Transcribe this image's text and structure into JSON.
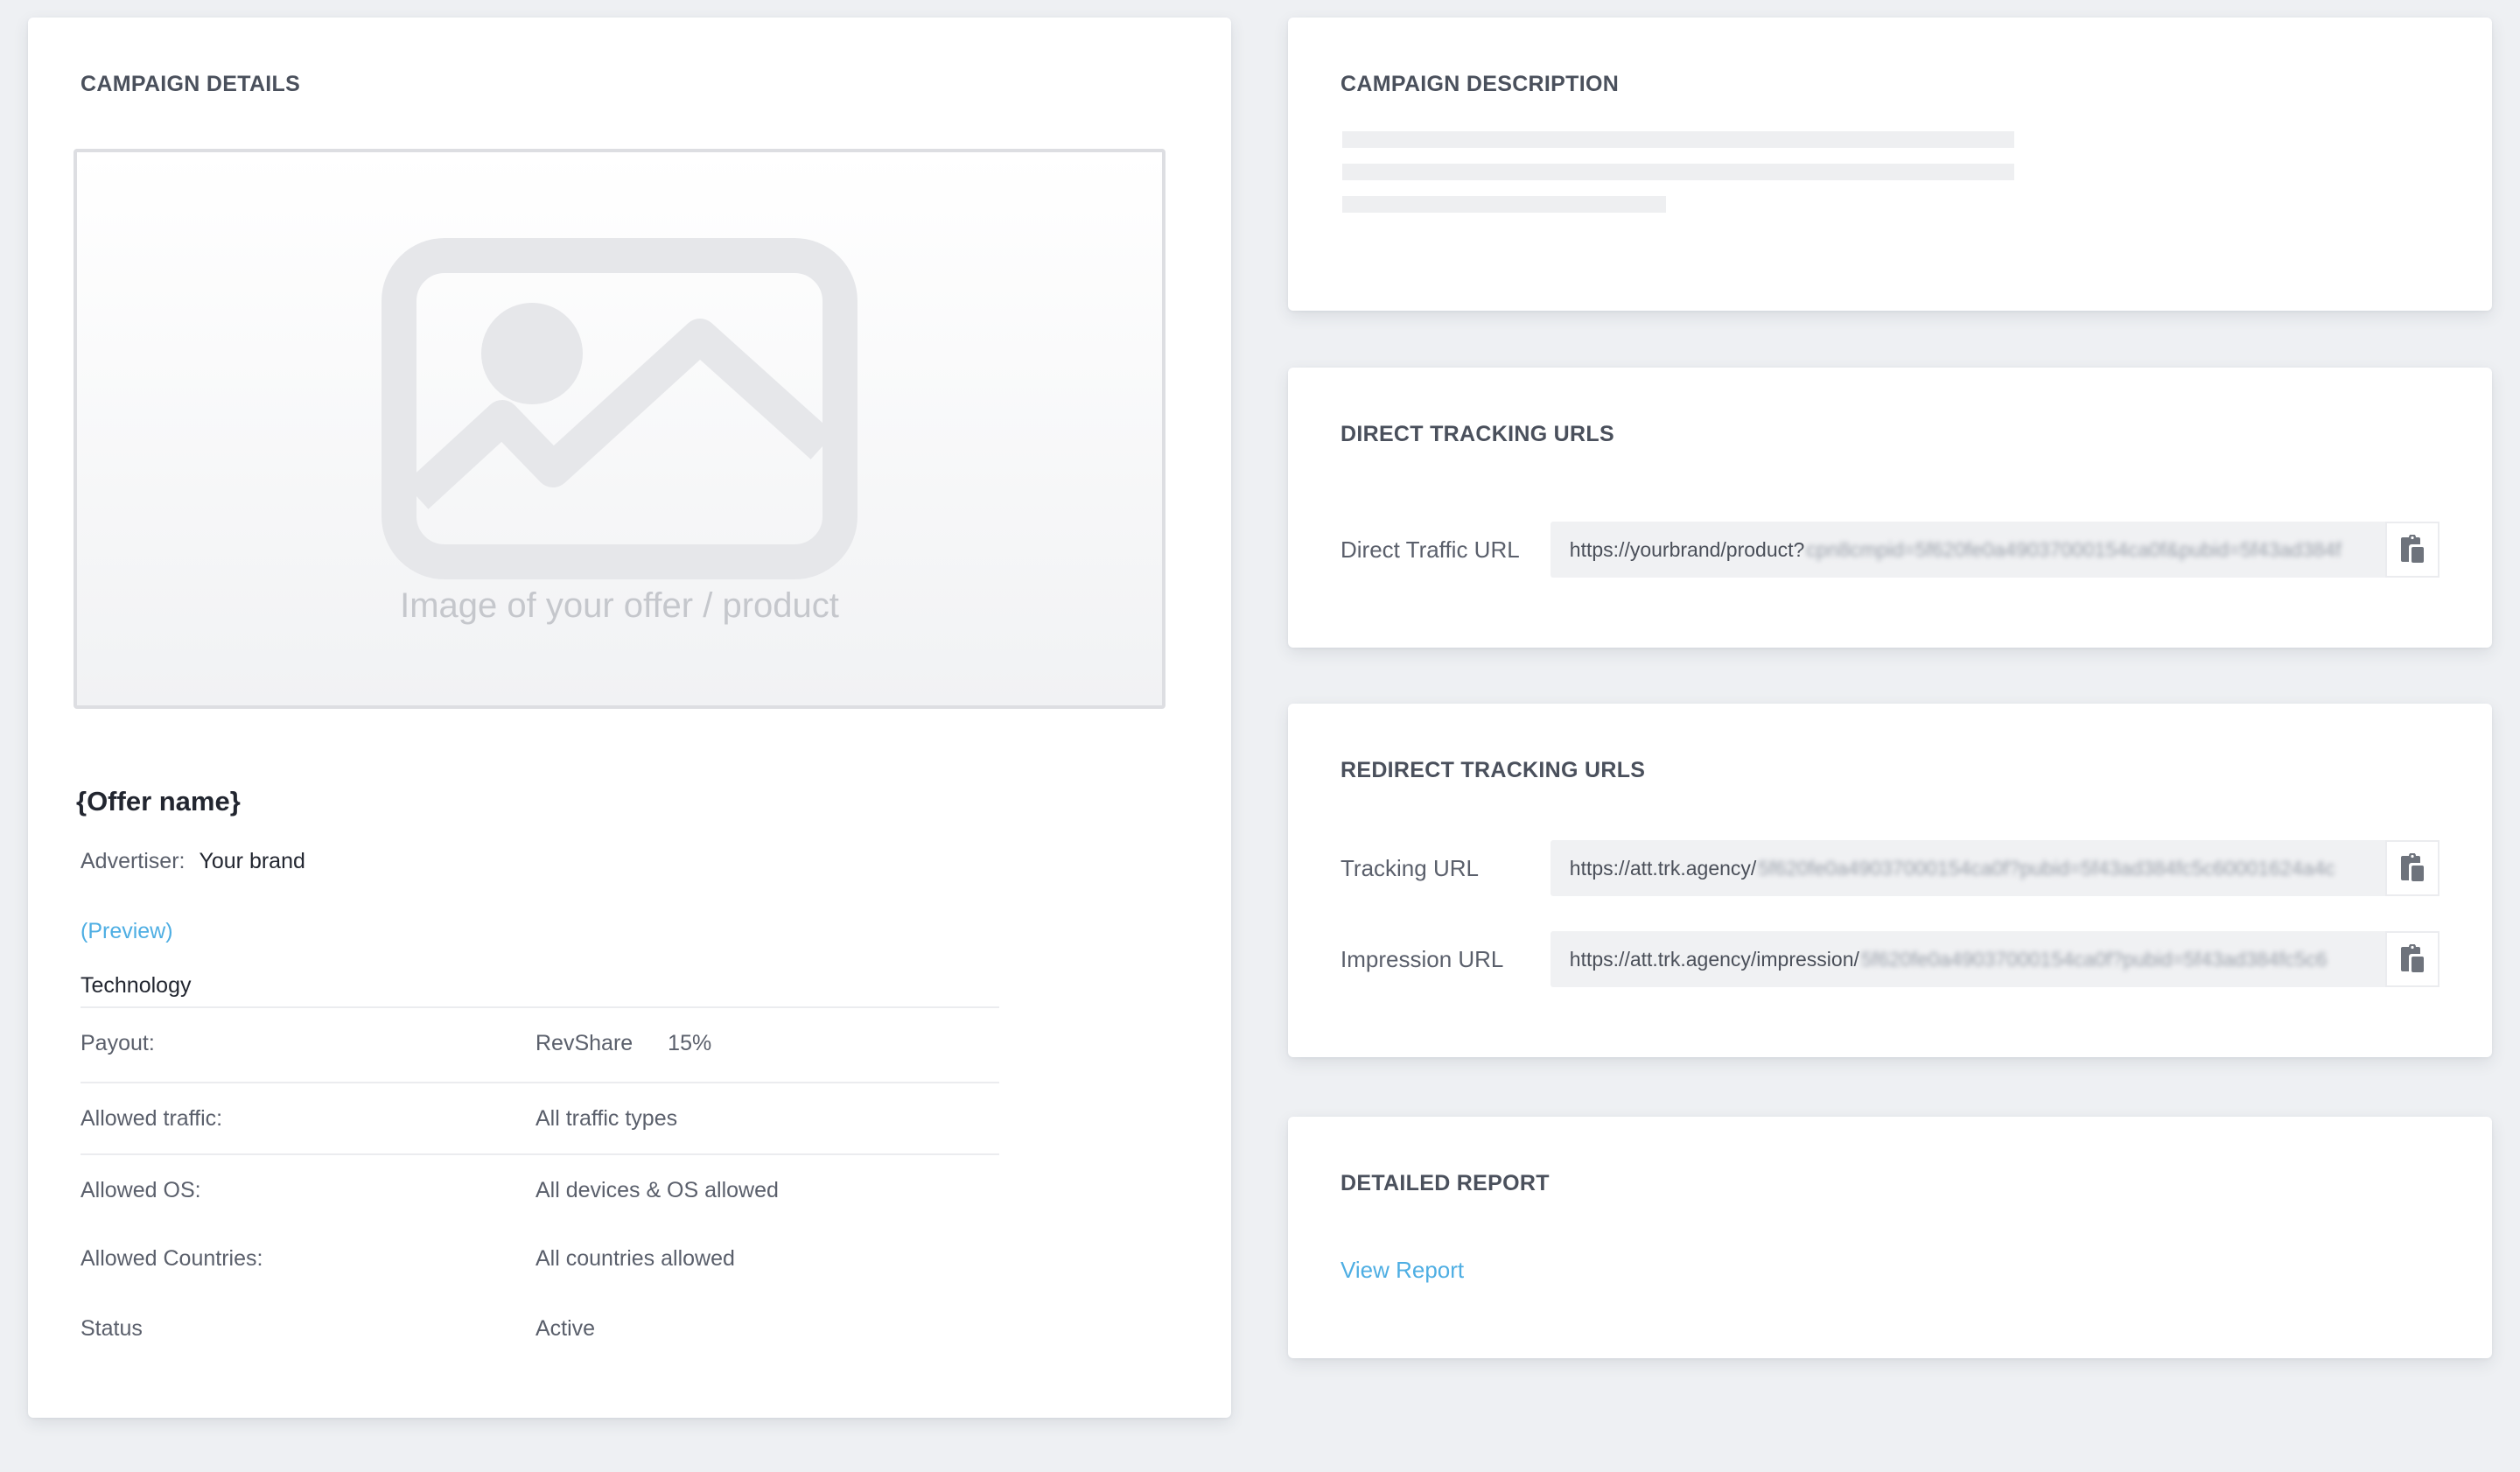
{
  "details": {
    "title": "CAMPAIGN DETAILS",
    "image_caption": "Image of your offer / product",
    "offer_name": "{Offer name}",
    "advertiser_label": "Advertiser:",
    "advertiser_value": "Your brand",
    "preview_link": "(Preview)",
    "category": "Technology",
    "rows": [
      {
        "label": "Payout:",
        "value": "RevShare",
        "extra": "15%"
      },
      {
        "label": "Allowed traffic:",
        "value": "All traffic types"
      },
      {
        "label": "Allowed OS:",
        "value": "All devices & OS allowed"
      },
      {
        "label": "Allowed Countries:",
        "value": "All countries allowed"
      },
      {
        "label": "Status",
        "value": "Active"
      }
    ]
  },
  "description": {
    "title": "CAMPAIGN DESCRIPTION"
  },
  "direct": {
    "title": "DIRECT TRACKING URLS",
    "urls": [
      {
        "label": "Direct Traffic URL",
        "visible": "https://yourbrand/product?",
        "blurred": "cpn8cmpid=5f620fe0a49037000154ca0f&pubid=5f43ad384f"
      }
    ]
  },
  "redirect": {
    "title": "REDIRECT TRACKING URLS",
    "urls": [
      {
        "label": "Tracking URL",
        "visible": "https://att.trk.agency/",
        "blurred": "5f620fe0a49037000154ca0f?pubid=5f43ad384fc5c60001624a4c"
      },
      {
        "label": "Impression URL",
        "visible": "https://att.trk.agency/impression/",
        "blurred": "5f620fe0a49037000154ca0f?pubid=5f43ad384fc5c6"
      }
    ]
  },
  "report": {
    "title": "DETAILED REPORT",
    "link": "View Report"
  },
  "icons": {
    "image": "image-placeholder-icon",
    "copy": "clipboard-copy-icon"
  }
}
